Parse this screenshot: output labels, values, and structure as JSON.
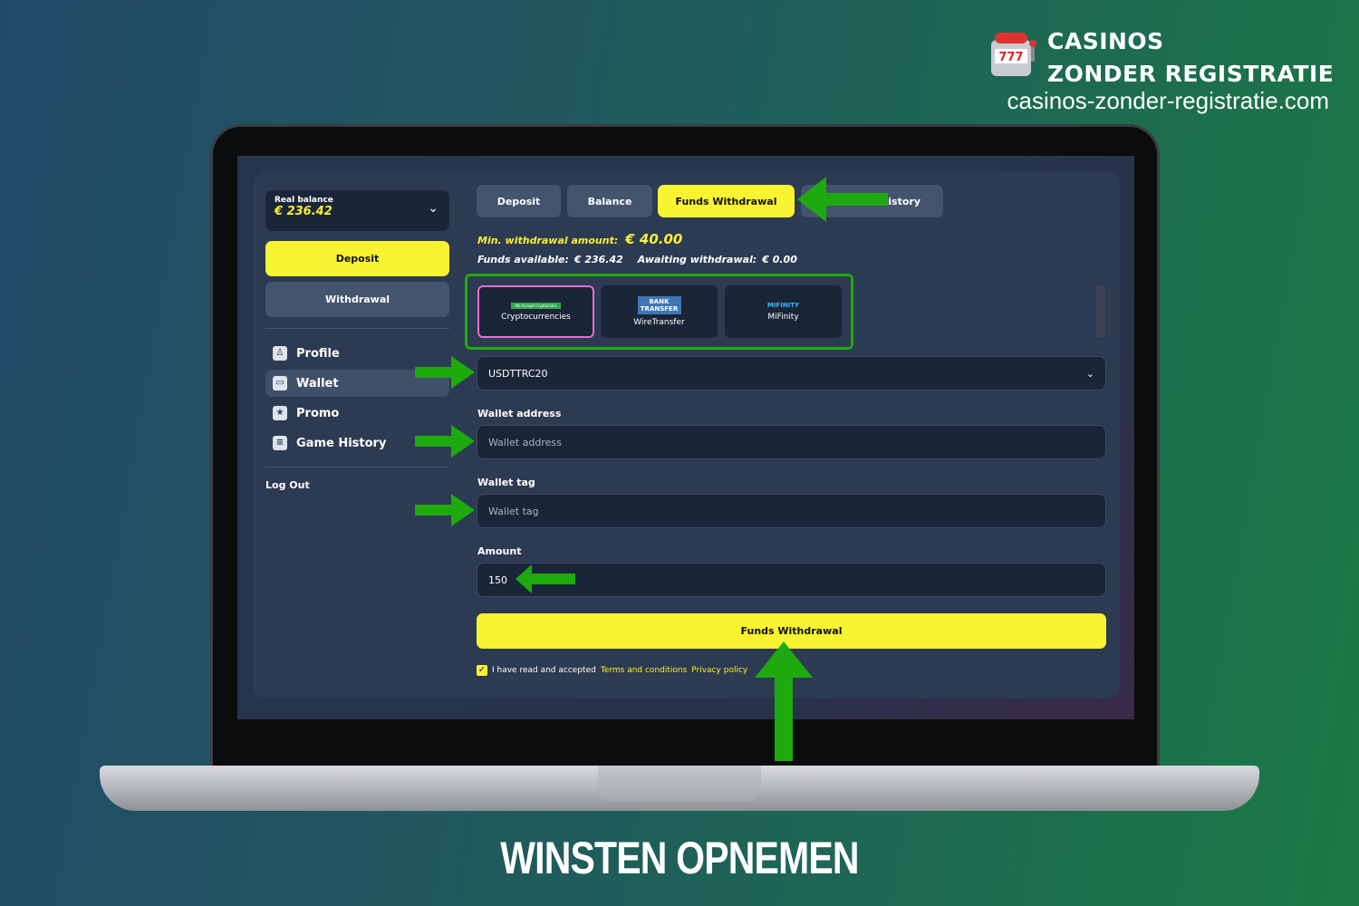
{
  "brand": {
    "line1": "CASINOS",
    "line2": "ZONDER REGISTRATIE",
    "url": "casinos-zonder-registratie.com",
    "logo_text": "777"
  },
  "sidebar": {
    "balance_label": "Real balance",
    "balance_value": "€ 236.42",
    "deposit": "Deposit",
    "withdrawal": "Withdrawal",
    "items": [
      {
        "label": "Profile",
        "icon": "profile-icon"
      },
      {
        "label": "Wallet",
        "icon": "wallet-icon",
        "active": true
      },
      {
        "label": "Promo",
        "icon": "promo-icon"
      },
      {
        "label": "Game History",
        "icon": "game-history-icon"
      }
    ],
    "logout": "Log Out"
  },
  "tabs": [
    {
      "label": "Deposit"
    },
    {
      "label": "Balance"
    },
    {
      "label": "Funds Withdrawal",
      "active": true
    },
    {
      "label": "History"
    }
  ],
  "info": {
    "min_label": "Min. withdrawal amount:",
    "min_value": "€ 40.00",
    "funds_label": "Funds available:",
    "funds_value": "€ 236.42",
    "await_label": "Awaiting withdrawal:",
    "await_value": "€ 0.00"
  },
  "methods": [
    {
      "label": "Cryptocurrencies",
      "logo": "We Accept Cryptocoins",
      "selected": true
    },
    {
      "label": "WireTransfer",
      "logo": "BANK TRANSFER"
    },
    {
      "label": "MiFinity",
      "logo": "MIFINITY"
    }
  ],
  "form": {
    "currency": "USDTTRC20",
    "wallet_address_label": "Wallet address",
    "wallet_address_placeholder": "Wallet address",
    "wallet_tag_label": "Wallet tag",
    "wallet_tag_placeholder": "Wallet tag",
    "amount_label": "Amount",
    "amount_value": "150",
    "submit": "Funds Withdrawal",
    "terms_prefix": "I have read and accepted",
    "terms_link": "Terms and conditions",
    "privacy_link": "Privacy policy",
    "terms_checked": true
  },
  "caption": "WINSTEN OPNEMEN",
  "colors": {
    "accent": "#f9f432",
    "arrow": "#1eaa0e",
    "highlight": "#1eaa0e",
    "selected_border": "#f06cd6"
  }
}
